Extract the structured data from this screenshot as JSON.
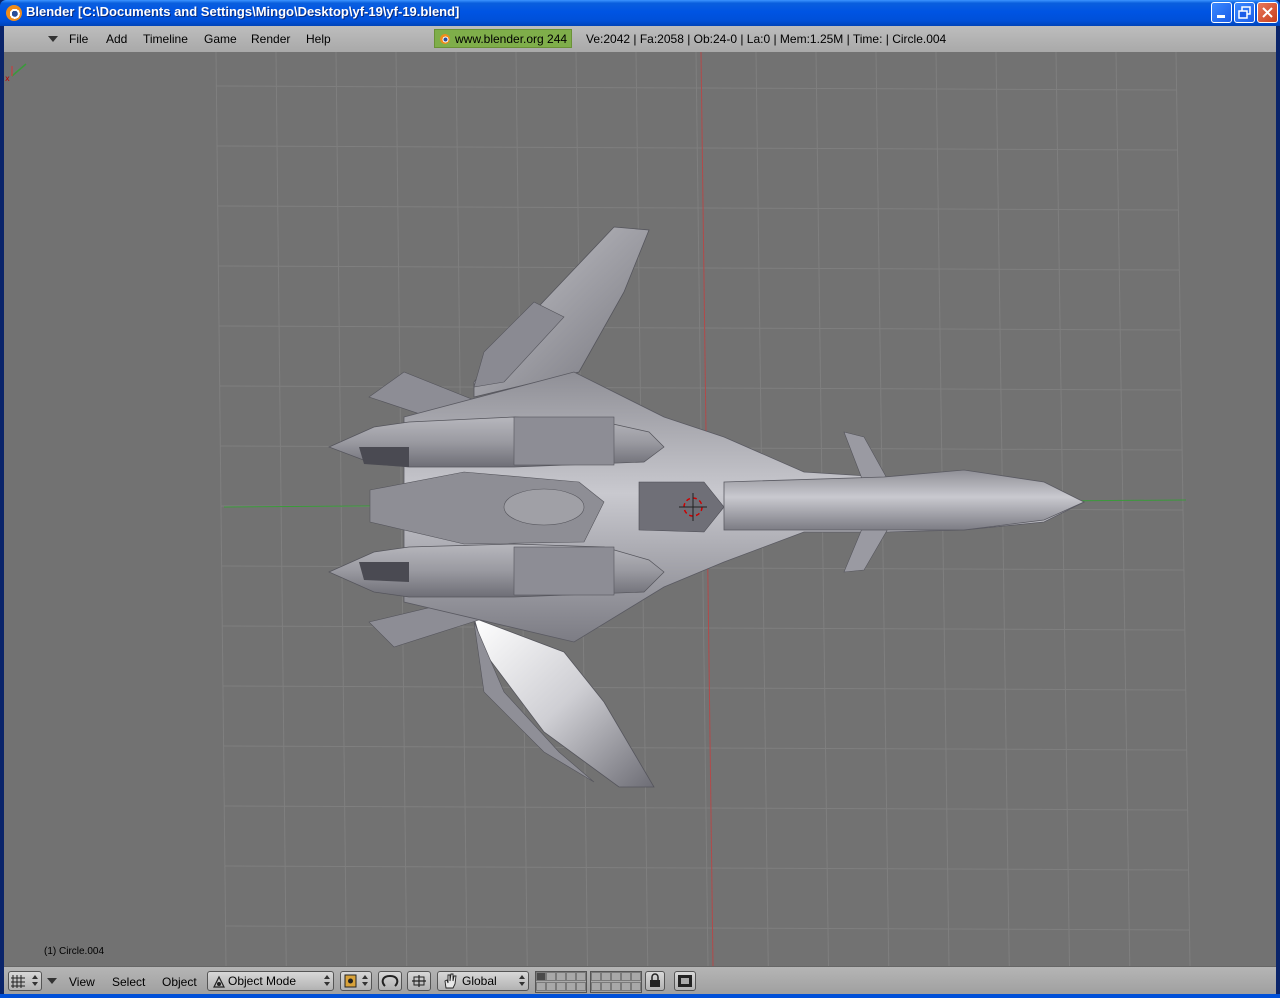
{
  "window": {
    "title": "Blender [C:\\Documents and Settings\\Mingo\\Desktop\\yf-19\\yf-19.blend]"
  },
  "top_menu": {
    "items": [
      "File",
      "Add",
      "Timeline",
      "Game",
      "Render",
      "Help"
    ],
    "website": "www.blender.org 244",
    "stats": "Ve:2042 | Fa:2058 | Ob:24-0 | La:0  | Mem:1.25M  | Time: | Circle.004"
  },
  "viewport": {
    "selected_object_label": "(1) Circle.004",
    "background_color": "#727272",
    "grid_color": "#7f7f7f",
    "x_axis_color": "#3a9a3a",
    "y_axis_color": "#b24a4a",
    "model_color": "#a9a9b0",
    "icons": [
      "3d-cursor-icon",
      "axis-gizmo-icon"
    ]
  },
  "bottom_header": {
    "view_label": "View",
    "select_label": "Select",
    "object_label": "Object",
    "mode_value": "Object Mode",
    "orientation_value": "Global",
    "icons": [
      "editor-type-icon",
      "pivot-icon",
      "manipulator-icon",
      "manipulator-translate-icon",
      "hand-icon",
      "lock-icon",
      "render-icon"
    ]
  }
}
